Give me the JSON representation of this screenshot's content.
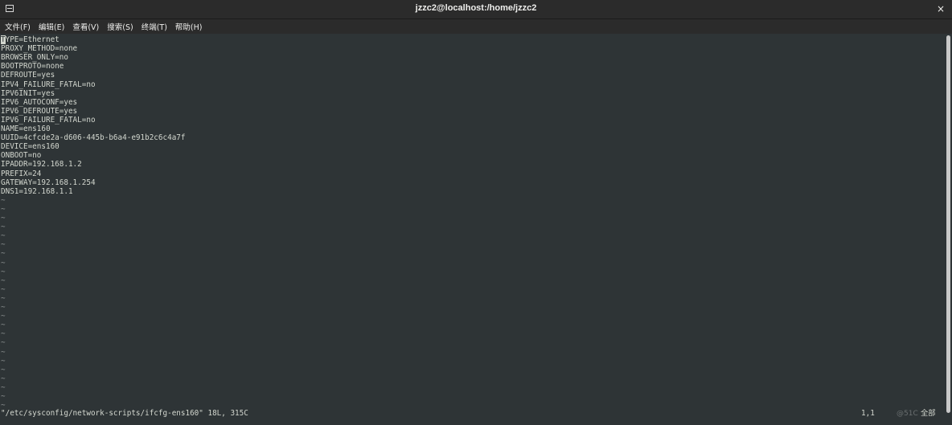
{
  "window": {
    "title": "jzzc2@localhost:/home/jzzc2",
    "close_label": "×"
  },
  "menu": [
    {
      "label": "文件(F)"
    },
    {
      "label": "编辑(E)"
    },
    {
      "label": "查看(V)"
    },
    {
      "label": "搜索(S)"
    },
    {
      "label": "终端(T)"
    },
    {
      "label": "帮助(H)"
    }
  ],
  "editor": {
    "cursor_char": "T",
    "first_line_rest": "YPE=Ethernet",
    "lines": [
      "PROXY_METHOD=none",
      "BROWSER_ONLY=no",
      "BOOTPROTO=none",
      "DEFROUTE=yes",
      "IPV4_FAILURE_FATAL=no",
      "IPV6INIT=yes",
      "IPV6_AUTOCONF=yes",
      "IPV6_DEFROUTE=yes",
      "IPV6_FAILURE_FATAL=no",
      "NAME=ens160",
      "UUID=4cfcde2a-d606-445b-b6a4-e91b2c6c4a7f",
      "DEVICE=ens160",
      "ONBOOT=no",
      "IPADDR=192.168.1.2",
      "PREFIX=24",
      "GATEWAY=192.168.1.254",
      "DNS1=192.168.1.1"
    ],
    "tilde": "~",
    "tilde_count": 24
  },
  "status": {
    "file_info": "\"/etc/sysconfig/network-scripts/ifcfg-ens160\" 18L, 315C",
    "position": "1,1",
    "scroll_pos": "全部"
  },
  "watermark": "@51C",
  "colors": {
    "background": "#2e3436",
    "foreground": "#d3d7cf",
    "titlebar": "#2b2b2b"
  }
}
